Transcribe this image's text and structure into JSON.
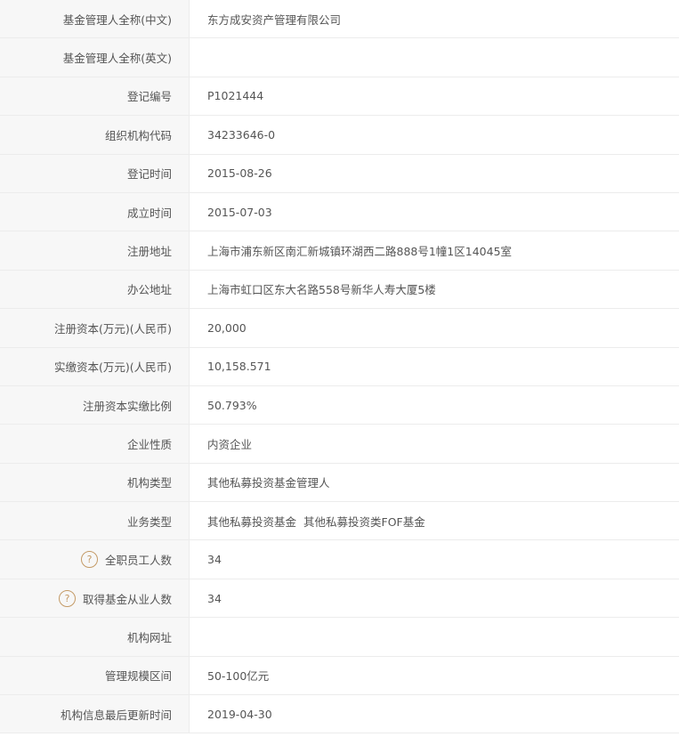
{
  "rows": [
    {
      "label": "基金管理人全称(中文)",
      "value": "东方成安资产管理有限公司"
    },
    {
      "label": "基金管理人全称(英文)",
      "value": ""
    },
    {
      "label": "登记编号",
      "value": "P1021444"
    },
    {
      "label": "组织机构代码",
      "value": "34233646-0"
    },
    {
      "label": "登记时间",
      "value": "2015-08-26"
    },
    {
      "label": "成立时间",
      "value": "2015-07-03"
    },
    {
      "label": "注册地址",
      "value": "上海市浦东新区南汇新城镇环湖西二路888号1幢1区14045室"
    },
    {
      "label": "办公地址",
      "value": "上海市虹口区东大名路558号新华人寿大厦5楼"
    },
    {
      "label": "注册资本(万元)(人民币)",
      "value": "20,000"
    },
    {
      "label": "实缴资本(万元)(人民币)",
      "value": "10,158.571"
    },
    {
      "label": "注册资本实缴比例",
      "value": "50.793%"
    },
    {
      "label": "企业性质",
      "value": "内资企业"
    },
    {
      "label": "机构类型",
      "value": "其他私募投资基金管理人"
    },
    {
      "label": "业务类型",
      "value": "其他私募投资基金",
      "value2": "其他私募投资类FOF基金"
    },
    {
      "label": "全职员工人数",
      "value": "34",
      "help": "?"
    },
    {
      "label": "取得基金从业人数",
      "value": "34",
      "help": "?"
    },
    {
      "label": "机构网址",
      "value": ""
    },
    {
      "label": "管理规模区间",
      "value": "50-100亿元"
    },
    {
      "label": "机构信息最后更新时间",
      "value": "2019-04-30"
    }
  ],
  "colors": {
    "label_bg": "#f7f7f7",
    "border": "#ececec",
    "text": "#555555",
    "help_icon": "#c49a66"
  }
}
